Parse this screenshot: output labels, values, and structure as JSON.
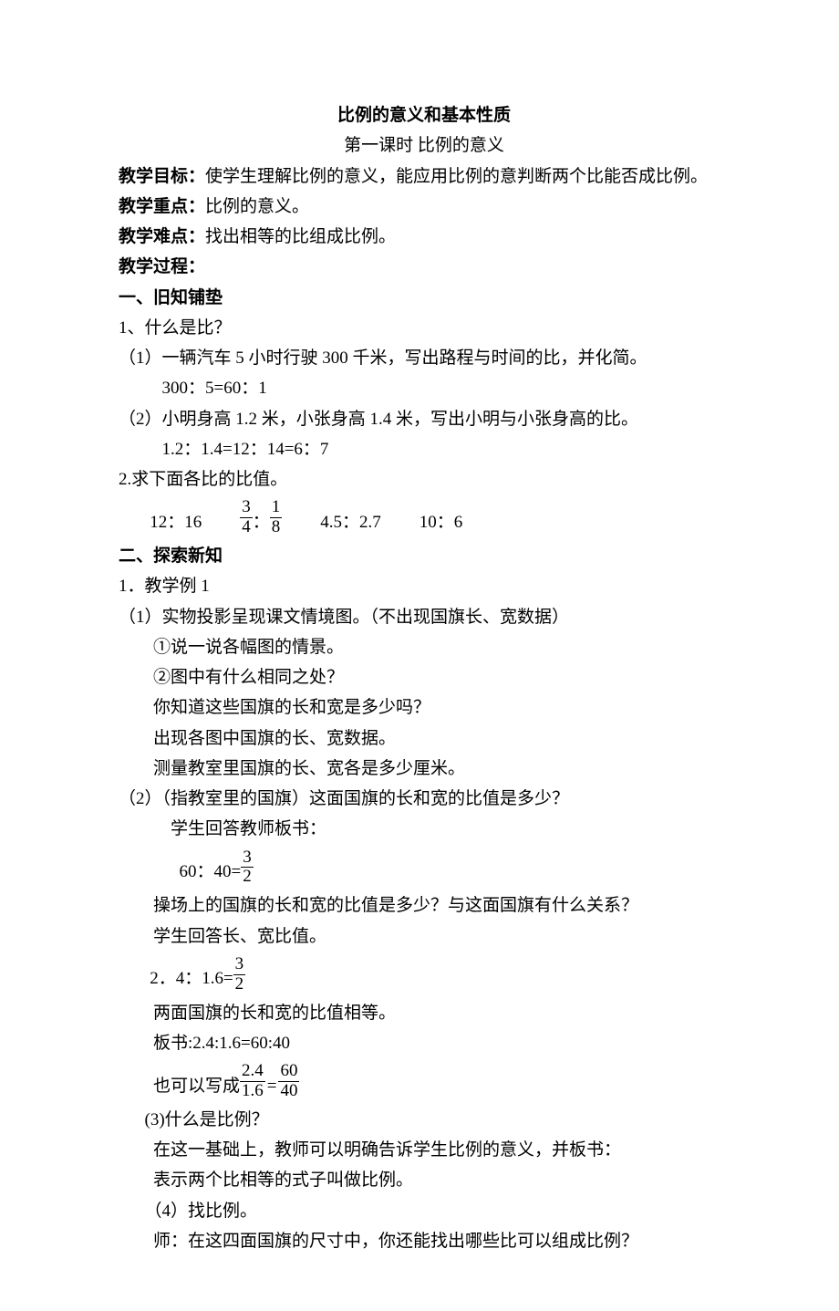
{
  "title": "比例的意义和基本性质",
  "subtitle": "第一课时 比例的意义",
  "labels": {
    "goal_label": "教学目标：",
    "goal_text": "使学生理解比例的意义，能应用比例的意判断两个比能否成比例。",
    "key_label": "教学重点：",
    "key_text": "比例的意义。",
    "hard_label": "教学难点：",
    "hard_text": "找出相等的比组成比例。",
    "process_label": "教学过程："
  },
  "section1": {
    "head": "一、旧知铺垫",
    "q1": "1、什么是比？",
    "q1_1": "（1）一辆汽车 5 小时行驶 300 千米，写出路程与时间的比，并化简。",
    "q1_1_ans": "300：5=60：1",
    "q1_2": "（2）小明身高 1.2 米，小张身高 1.4 米，写出小明与小张身高的比。",
    "q1_2_ans": "1.2：1.4=12：14=6：7",
    "q2": "2.求下面各比的比值。",
    "ratios": {
      "r1": "12：16",
      "r2_n": "3",
      "r2_d": "4",
      "r2_sep": "：",
      "r3_n": "1",
      "r3_d": "8",
      "r4": "4.5：2.7",
      "r5": "10：6"
    }
  },
  "section2": {
    "head": "二、探索新知",
    "p1": "1．教学例 1",
    "p1_1": "（1）实物投影呈现课文情境图。（不出现国旗长、宽数据）",
    "p1_1_a": "①说一说各幅图的情景。",
    "p1_1_b": "②图中有什么相同之处？",
    "p1_1_c": "你知道这些国旗的长和宽是多少吗？",
    "p1_1_d": "出现各图中国旗的长、宽数据。",
    "p1_1_e": "测量教室里国旗的长、宽各是多少厘米。",
    "p1_2": "（2）（指教室里的国旗）这面国旗的长和宽的比值是多少？",
    "p1_2_a": "学生回答教师板书：",
    "calc1_prefix": "60：40=",
    "calc1_n": "3",
    "calc1_d": "2",
    "p1_2_b": "操场上的国旗的长和宽的比值是多少？与这面国旗有什么关系？",
    "p1_2_c": "学生回答长、宽比值。",
    "calc2_prefix": "2．4：1.6=",
    "calc2_n": "3",
    "calc2_d": "2",
    "p1_2_d": "两面国旗的长和宽的比值相等。",
    "p1_2_e": "板书:2.4:1.6=60:40",
    "p1_2_f_prefix": "也可以写成",
    "calc3_n1": "2.4",
    "calc3_d1": "1.6",
    "calc3_eq": "=",
    "calc3_n2": "60",
    "calc3_d2": "40",
    "p1_3": "(3)什么是比例？",
    "p1_3_a": "在这一基础上，教师可以明确告诉学生比例的意义，并板书：",
    "p1_3_b": "表示两个比相等的式子叫做比例。",
    "p1_4": "（4）找比例。",
    "p1_4_a": "师：在这四面国旗的尺寸中，你还能找出哪些比可以组成比例？"
  }
}
